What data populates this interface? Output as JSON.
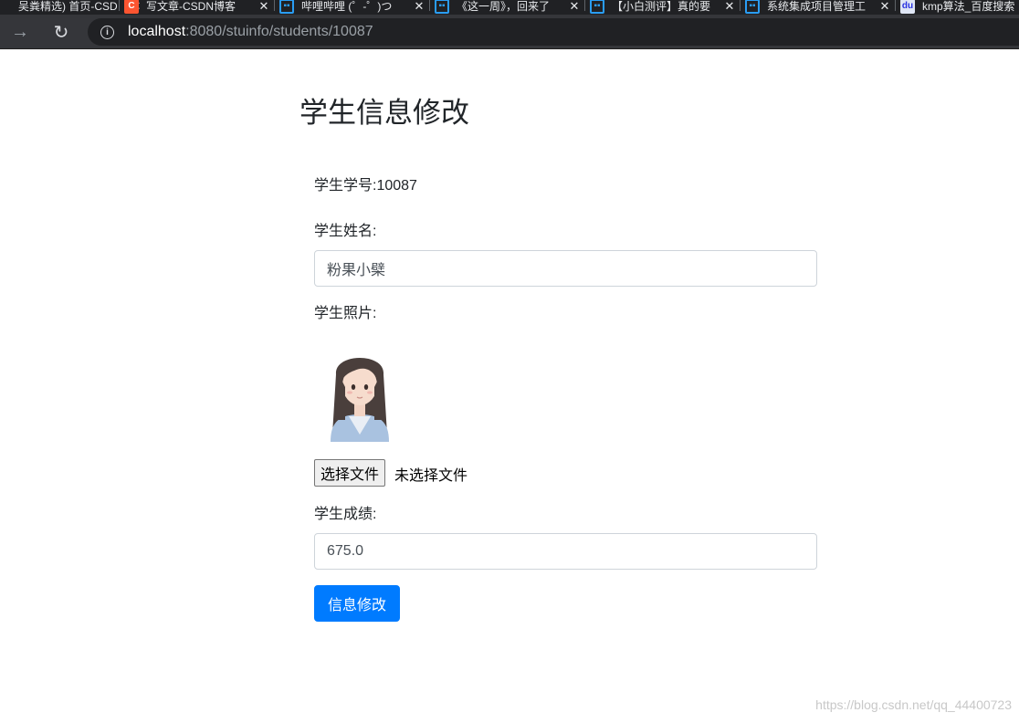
{
  "browser": {
    "tabs": [
      {
        "title": "吴粪精选) 首页-CSD",
        "favicon": "none"
      },
      {
        "title": "写文章-CSDN博客",
        "favicon": "csdn"
      },
      {
        "title": "哔哩哔哩 (゜-゜)つ",
        "favicon": "bilibili"
      },
      {
        "title": "《这一周》，回来了",
        "favicon": "bilibili"
      },
      {
        "title": "【小白测评】真的要",
        "favicon": "bilibili"
      },
      {
        "title": "系统集成项目管理工",
        "favicon": "bilibili"
      },
      {
        "title": "kmp算法_百度搜索",
        "favicon": "baidu"
      }
    ],
    "tab_close_glyph": "✕",
    "forward_glyph": "→",
    "reload_glyph": "↻",
    "info_glyph": "i",
    "url_host": "localhost",
    "url_rest": ":8080/stuinfo/students/10087"
  },
  "page": {
    "title": "学生信息修改",
    "student_id_text": "学生学号:10087",
    "name_label": "学生姓名:",
    "name_value": "粉果小檗",
    "photo_label": "学生照片:",
    "file_button": "选择文件",
    "file_status": "未选择文件",
    "score_label": "学生成绩:",
    "score_value": "675.0",
    "submit_label": "信息修改"
  },
  "watermark": "https://blog.csdn.net/qq_44400723",
  "colors": {
    "primary": "#007bff",
    "chrome_dark": "#202124",
    "toolbar": "#35363a"
  }
}
